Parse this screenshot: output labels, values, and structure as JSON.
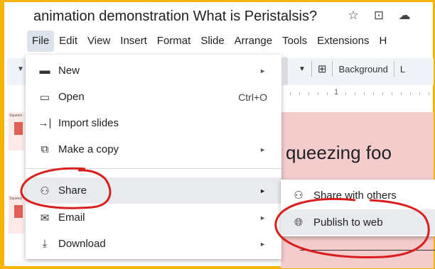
{
  "doc": {
    "title": "animation demonstration What is Peristalsis?",
    "icons": [
      "star-icon",
      "move-to-folder-icon",
      "cloud-status-icon"
    ]
  },
  "menubar": {
    "items": [
      "File",
      "Edit",
      "View",
      "Insert",
      "Format",
      "Slide",
      "Arrange",
      "Tools",
      "Extensions",
      "H"
    ]
  },
  "toolbar": {
    "background_label": "Background",
    "cut_label": "L"
  },
  "ruler": {
    "mark": "1"
  },
  "thumbnails": [
    {
      "label": "Squeezi",
      "box": "Circul on it"
    },
    {
      "label": "Squeezi",
      "box": "Circul on it"
    }
  ],
  "slide": {
    "text": "queezing foo"
  },
  "file_menu": {
    "items": [
      {
        "label": "New",
        "icon": "new-icon",
        "arrow": "►"
      },
      {
        "label": "Open",
        "icon": "folder-icon",
        "shortcut": "Ctrl+O"
      },
      {
        "label": "Import slides",
        "icon": "import-icon"
      },
      {
        "label": "Make a copy",
        "icon": "copy-icon",
        "arrow": "►"
      },
      {
        "label": "Share",
        "icon": "share-person-icon",
        "arrow": "►"
      },
      {
        "label": "Email",
        "icon": "email-icon",
        "arrow": "►"
      },
      {
        "label": "Download",
        "icon": "download-icon",
        "arrow": "►"
      }
    ]
  },
  "share_submenu": {
    "items": [
      {
        "label": "Share with others",
        "icon": "share-person-icon"
      },
      {
        "label": "Publish to web",
        "icon": "globe-icon"
      }
    ]
  },
  "colors": {
    "frame": "#f4b400",
    "annotation": "#d91e1e",
    "hover": "#e8eaed",
    "slide_bg": "#f4cccc",
    "thumb_accent": "#e06055"
  }
}
